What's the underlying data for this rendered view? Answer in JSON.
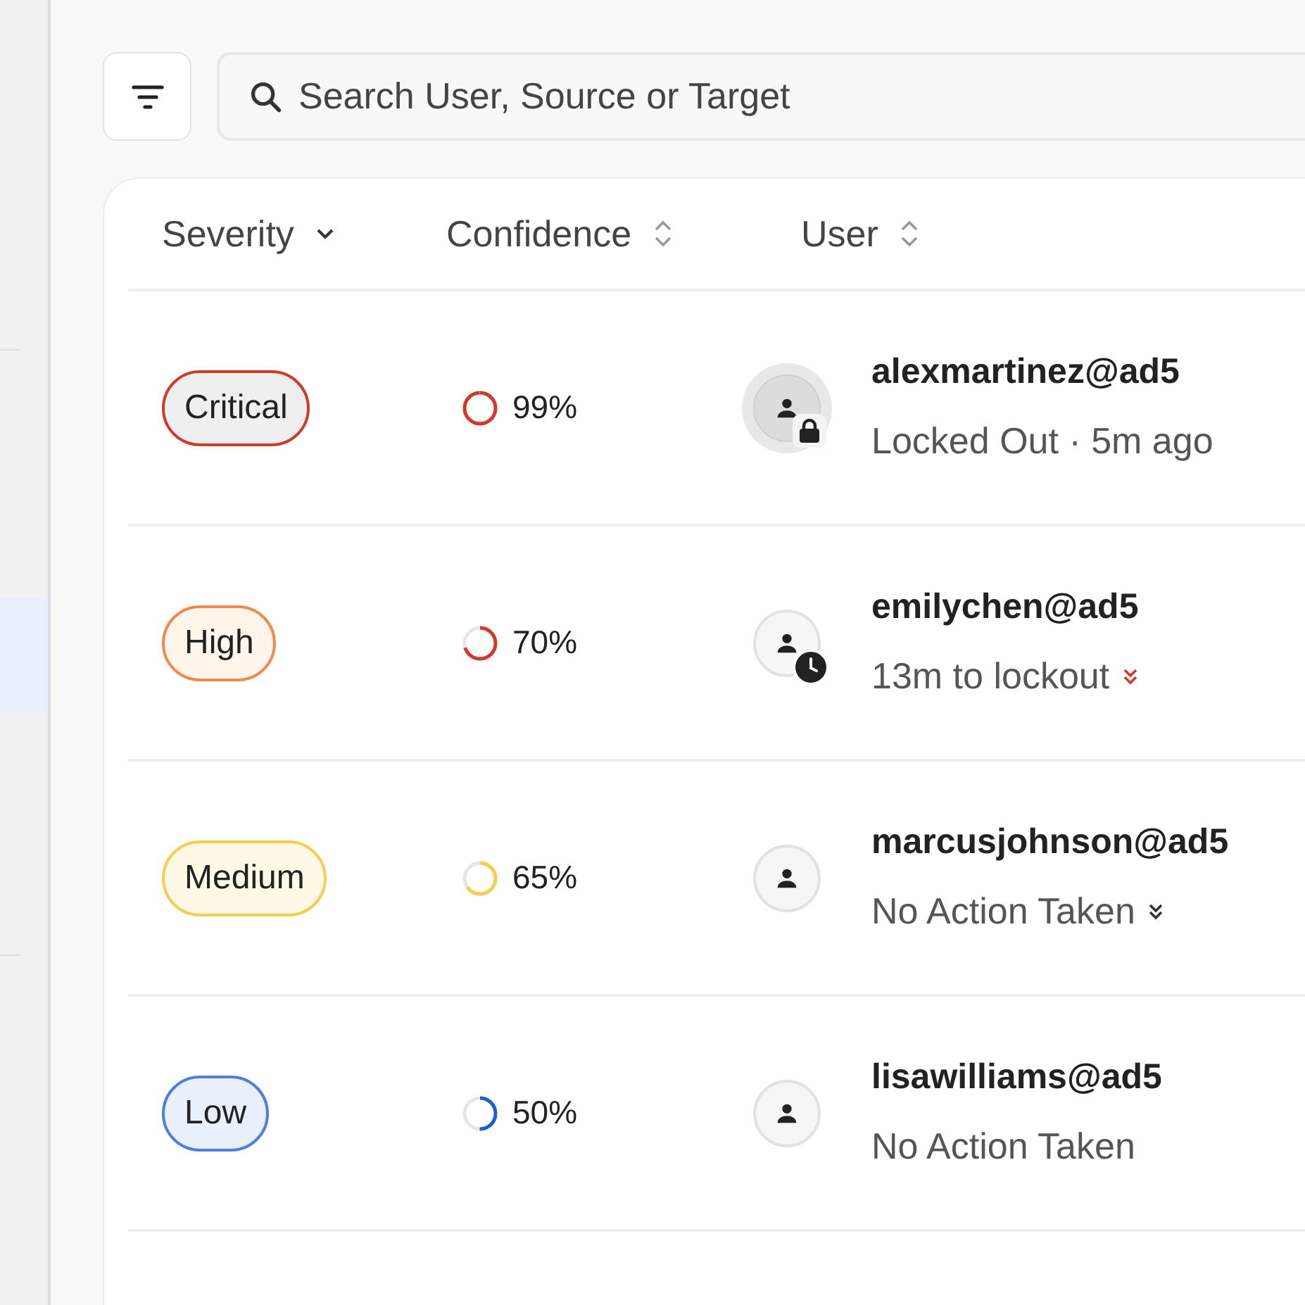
{
  "search": {
    "placeholder": "Search User, Source or Target"
  },
  "table": {
    "columns": [
      {
        "label": "Severity",
        "sorted": true
      },
      {
        "label": "Confidence",
        "sorted": false
      },
      {
        "label": "User",
        "sorted": false
      }
    ],
    "rows": [
      {
        "severity": {
          "label": "Critical",
          "kind": "critical",
          "color": "#d03a2b"
        },
        "confidence": {
          "level": 0.99,
          "reading": "99%"
        },
        "user": {
          "name": "alexmartinez@ad5",
          "status": "Locked Out · 5m ago",
          "avatar": {
            "kind": "locked"
          }
        }
      },
      {
        "severity": {
          "label": "High",
          "kind": "high",
          "color": "#f08a4b"
        },
        "confidence": {
          "level": 0.7,
          "reading": "70%"
        },
        "user": {
          "name": "emilychen@ad5",
          "status": "13m to lockout",
          "avatar": {
            "kind": "pending"
          },
          "chevron": {
            "color": "#d03a2b"
          }
        }
      },
      {
        "severity": {
          "label": "Medium",
          "kind": "medium",
          "color": "#f7cd4f"
        },
        "confidence": {
          "level": 0.65,
          "reading": "65%"
        },
        "user": {
          "name": "marcusjohnson@ad5",
          "status": "No Action Taken",
          "avatar": {
            "kind": "default"
          },
          "chevron": {
            "color": "#333333"
          }
        }
      },
      {
        "severity": {
          "label": "Low",
          "kind": "low",
          "color": "#4a7fdc"
        },
        "confidence": {
          "level": 0.5,
          "reading": "50%"
        },
        "user": {
          "name": "lisawilliams@ad5",
          "status": "No Action Taken",
          "avatar": {
            "kind": "default"
          }
        }
      }
    ]
  }
}
